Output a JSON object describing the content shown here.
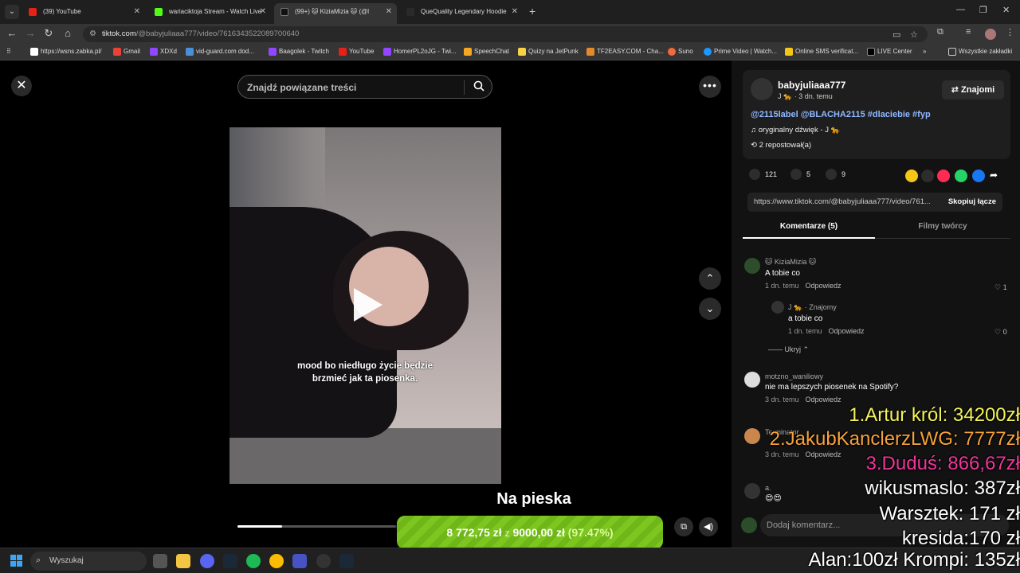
{
  "browser": {
    "tabs": [
      {
        "title": "(39) YouTube",
        "color": "#e62117"
      },
      {
        "title": "wariaciktoja Stream - Watch Live",
        "color": "#53fc18"
      },
      {
        "title": "(99+) 🐱 KiziaMizia 🐱 (@l",
        "color": "#111111"
      },
      {
        "title": "QueQuality Legendary Hoodie",
        "color": "#2a2a2a"
      }
    ],
    "url_host": "tiktok.com",
    "url_path": "/@babyjuliaaa777/video/7616343522089700640",
    "bookmarks": [
      {
        "label": "https://wsns.zabka.pl/",
        "color": "#ffffff"
      },
      {
        "label": "Gmail",
        "color": "#ea4335"
      },
      {
        "label": "XDXd",
        "color": "#9146ff"
      },
      {
        "label": "vid-guard.com dod...",
        "color": "#4a90d9"
      },
      {
        "label": "Baagolek - Twitch",
        "color": "#9146ff"
      },
      {
        "label": "YouTube",
        "color": "#e62117"
      },
      {
        "label": "HomerPL2oJG - Twi...",
        "color": "#9146ff"
      },
      {
        "label": "SpeechChat",
        "color": "#f5a623"
      },
      {
        "label": "Quizy na JetPunk",
        "color": "#f8d147"
      },
      {
        "label": "TF2EASY.COM - Cha...",
        "color": "#e28a2b"
      },
      {
        "label": "Suno",
        "color": "#f06a3c"
      },
      {
        "label": "Prime Video | Watch...",
        "color": "#1a98ff"
      },
      {
        "label": "Online SMS verificat...",
        "color": "#f5c518"
      },
      {
        "label": "LIVE Center",
        "color": "#000000"
      }
    ],
    "all_bookmarks": "Wszystkie zakładki"
  },
  "video": {
    "search_placeholder": "Znajdź powiązane treści",
    "caption": "mood bo niedługo życie będzie brzmieć jak ta piosenka.",
    "title": "Na pieska",
    "progress": 0.28
  },
  "donation": {
    "current": "8 772,75 zł",
    "of": "z",
    "goal": "9000,00 zł",
    "percent": "(97.47%)"
  },
  "author": {
    "name": "babyjuliaaa777",
    "sub": "J 🐆 · 3 dn. temu",
    "follow_label": "Znajomi",
    "tags": "@2115label @BLACHA2115 #dlaciebie #fyp",
    "sound": "oryginalny dźwięk - J 🐆",
    "reposts": "2 repostował(a)"
  },
  "stats": {
    "likes": "121",
    "comments": "5",
    "saves": "9"
  },
  "link": {
    "url": "https://www.tiktok.com/@babyjuliaaa777/video/761...",
    "copy_label": "Skopiuj łącze"
  },
  "panel_tabs": {
    "comments": "Komentarze (5)",
    "creator": "Filmy twórcy"
  },
  "comments": [
    {
      "name": "🐱 KiziaMizia 🐱",
      "text": "A tobie co",
      "time": "1 dn. temu",
      "reply": "Odpowiedz",
      "likes": "1"
    },
    {
      "name": "J 🐆 · Znajomy",
      "text": "a tobie co",
      "time": "1 dn. temu",
      "reply": "Odpowiedz",
      "likes": "0"
    },
    {
      "hide": "Ukryj"
    },
    {
      "name": "motzno_waniliowy",
      "text": "nie ma lepszych piosenek na Spotify?",
      "time": "3 dn. temu",
      "reply": "Odpowiedz",
      "likes": "0"
    },
    {
      "name": "Terminator",
      "text": "",
      "time": "3 dn. temu",
      "reply": "Odpowiedz"
    },
    {
      "name": "a.",
      "text": "😍😍"
    }
  ],
  "add_comment_placeholder": "Dodaj komentarz...",
  "overlay": [
    {
      "text": "1.Artur król: 34200zł",
      "color": "#f2f25a"
    },
    {
      "text": "2.JakubKanclerzLWG: 7777zł",
      "color": "#f7a23a"
    },
    {
      "text": "3.Duduś: 866,67zł",
      "color": "#f0359a"
    },
    {
      "text": "wikusmaslo: 387zł",
      "color": "#ffffff"
    },
    {
      "text": "Warsztek: 171 zł",
      "color": "#ffffff"
    },
    {
      "text": "kresida:170 zł",
      "color": "#ffffff"
    },
    {
      "text": "Alan:100zł Krompi: 135zł",
      "color": "#ffffff"
    }
  ],
  "taskbar": {
    "search_placeholder": "Wyszukaj"
  }
}
